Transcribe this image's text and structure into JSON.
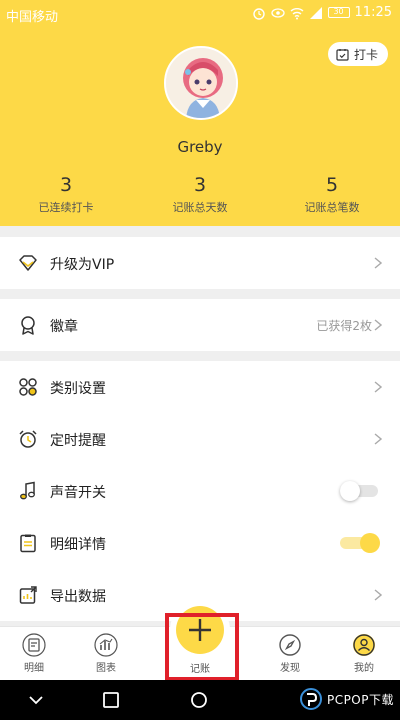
{
  "status_bar": {
    "carrier": "中国移动",
    "battery": "30",
    "time": "11:25"
  },
  "profile": {
    "checkin_label": "打卡",
    "username": "Greby",
    "stats": [
      {
        "value": "3",
        "label": "已连续打卡"
      },
      {
        "value": "3",
        "label": "记账总天数"
      },
      {
        "value": "5",
        "label": "记账总笔数"
      }
    ]
  },
  "menu": {
    "vip": "升级为VIP",
    "badge": "徽章",
    "badge_status": "已获得2枚",
    "category": "类别设置",
    "reminder": "定时提醒",
    "sound": "声音开关",
    "sound_on": false,
    "detail": "明细详情",
    "detail_on": true,
    "export": "导出数据"
  },
  "tabbar": {
    "items": [
      "明细",
      "图表",
      "记账",
      "发现",
      "我的"
    ]
  },
  "watermark": "PCPOP下载",
  "colors": {
    "accent": "#fdd947",
    "highlight": "#e0202a",
    "toggle_on": "#fdd947",
    "toggle_off": "#e4e4e4"
  }
}
